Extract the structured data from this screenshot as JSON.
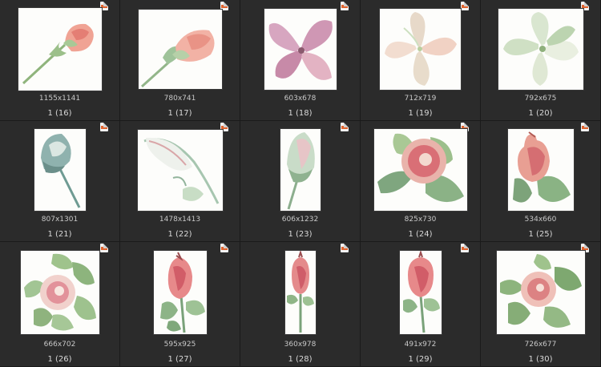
{
  "badge_icon": "png-file-badge-icon",
  "accent": "#e0642f",
  "items": [
    {
      "dims": "1155x1141",
      "name": "1 (16)",
      "art": "rosebud-pink-diagonal"
    },
    {
      "dims": "780x741",
      "name": "1 (17)",
      "art": "rosebud-pink-stem"
    },
    {
      "dims": "603x678",
      "name": "1 (18)",
      "art": "mauve-petal-flower"
    },
    {
      "dims": "712x719",
      "name": "1 (19)",
      "art": "pale-petal-flower"
    },
    {
      "dims": "792x675",
      "name": "1 (20)",
      "art": "green-white-flower"
    },
    {
      "dims": "807x1301",
      "name": "1 (21)",
      "art": "closed-bud-teal"
    },
    {
      "dims": "1478x1413",
      "name": "1 (22)",
      "art": "white-tulip-bud"
    },
    {
      "dims": "606x1232",
      "name": "1 (23)",
      "art": "closed-bud-green"
    },
    {
      "dims": "825x730",
      "name": "1 (24)",
      "art": "pink-berry-leaves"
    },
    {
      "dims": "534x660",
      "name": "1 (25)",
      "art": "pink-berry-upright"
    },
    {
      "dims": "666x702",
      "name": "1 (26)",
      "art": "berry-leaf-wreath"
    },
    {
      "dims": "595x925",
      "name": "1 (27)",
      "art": "rosehip-red"
    },
    {
      "dims": "360x978",
      "name": "1 (28)",
      "art": "rosehip-narrow"
    },
    {
      "dims": "491x972",
      "name": "1 (29)",
      "art": "rosehip-red-2"
    },
    {
      "dims": "726x677",
      "name": "1 (30)",
      "art": "berry-leaves-spread"
    }
  ]
}
